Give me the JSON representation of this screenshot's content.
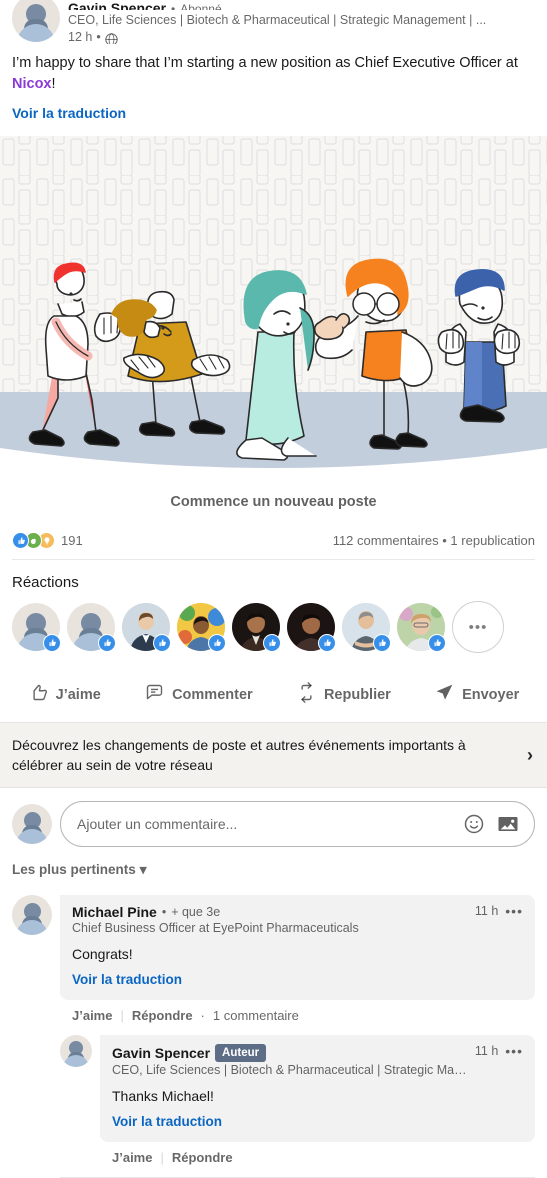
{
  "post": {
    "author_name": "Gavin Spencer",
    "author_dot": "•",
    "follow_label": "Abonné",
    "headline": "CEO, Life Sciences | Biotech & Pharmaceutical | Strategic Management | ...",
    "time": "12 h",
    "time_sep": "•",
    "visibility_icon": "globe-icon",
    "text_before_mention": "I’m happy to share that I’m starting a new position as Chief Executive Officer at ",
    "mention": "Nicox",
    "text_after_mention": "!",
    "translate_label": "Voir la traduction",
    "media_alt": "celebration-illustration"
  },
  "new_post_prompt": "Commence un nouveau poste",
  "social": {
    "reaction_icons": [
      "like-reaction-icon",
      "support-reaction-icon",
      "insightful-reaction-icon"
    ],
    "reaction_count": "191",
    "comments_and_reposts": "112 commentaires • 1 republication"
  },
  "reactions_section": {
    "title": "Réactions",
    "reactors": [
      {
        "type": "placeholder",
        "badge": "like-badge-icon"
      },
      {
        "type": "placeholder",
        "badge": "like-badge-icon"
      },
      {
        "type": "photo",
        "badge": "like-badge-icon",
        "c1": "#cfd9e2",
        "c2": "#2d3b4e",
        "c3": "#e8c9a8"
      },
      {
        "type": "photo",
        "badge": "like-badge-icon",
        "c1": "#f2c744",
        "c2": "#4a76a8",
        "c3": "#8a5a33"
      },
      {
        "type": "photo",
        "badge": "like-badge-icon",
        "c1": "#1a1412",
        "c2": "#3a2a22",
        "c3": "#a8724a"
      },
      {
        "type": "photo",
        "badge": "like-badge-icon",
        "c1": "#1c1413",
        "c2": "#43302b",
        "c3": "#a06a46"
      },
      {
        "type": "photo",
        "badge": "like-badge-icon",
        "c1": "#d7e2ea",
        "c2": "#5b6570",
        "c3": "#e3bf9b"
      },
      {
        "type": "photo",
        "badge": "like-badge-icon",
        "c1": "#bcd4a8",
        "c2": "#e9c8ac",
        "c3": "#cfa16a"
      }
    ],
    "more_label": "•••"
  },
  "actions": {
    "like": {
      "label": "J’aime",
      "icon": "thumbs-up-icon"
    },
    "comment": {
      "label": "Commenter",
      "icon": "comment-icon"
    },
    "repost": {
      "label": "Republier",
      "icon": "repost-icon"
    },
    "send": {
      "label": "Envoyer",
      "icon": "send-icon"
    }
  },
  "promo": {
    "text": "Découvrez les changements de poste et autres événements importants à célébrer au sein de votre réseau",
    "chevron": "›"
  },
  "compose": {
    "placeholder": "Ajouter un commentaire...",
    "emoji_icon": "emoji-icon",
    "image_icon": "image-icon"
  },
  "sort": {
    "label": "Les plus pertinents",
    "caret": "▾"
  },
  "comments": [
    {
      "name": "Michael Pine",
      "dot": "•",
      "degree": "+ que 3e",
      "headline": "Chief Business Officer at EyePoint Pharmaceuticals",
      "time": "11 h",
      "more": "•••",
      "text": "Congrats!",
      "translate": "Voir la traduction",
      "is_author": false,
      "actions": {
        "like": "J’aime",
        "reply": "Répondre",
        "replies_sep": "·",
        "replies": "1 commentaire"
      }
    },
    {
      "name": "Gavin Spencer",
      "author_badge": "Auteur",
      "headline": "CEO, Life Sciences | Biotech & Pharmaceutical | Strategic Manage...",
      "time": "11 h",
      "more": "•••",
      "text": "Thanks Michael!",
      "translate": "Voir la traduction",
      "is_author": true,
      "actions": {
        "like": "J’aime",
        "reply": "Répondre"
      }
    }
  ],
  "colors": {
    "link": "#0a66c2",
    "mention": "#8b3ad8",
    "author_badge_bg": "#5d6d85",
    "promo_bg": "#f4f2ee",
    "bubble_bg": "#f2f2f2",
    "like_blue": "#378fe9",
    "support_green": "#6dae4f",
    "insight_yellow": "#f5bb5c"
  }
}
